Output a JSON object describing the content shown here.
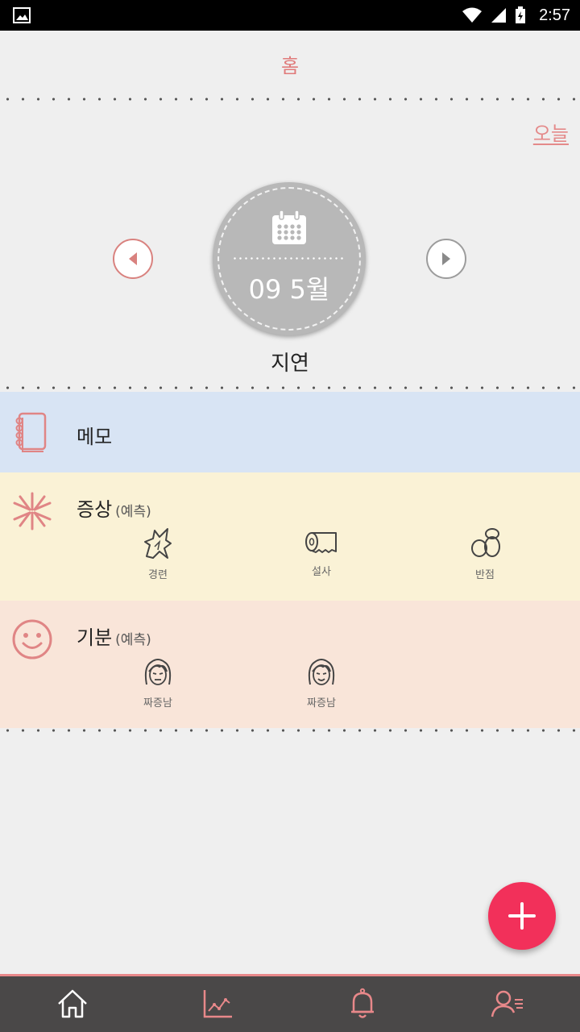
{
  "status_bar": {
    "time": "2:57"
  },
  "header": {
    "title": "홈"
  },
  "today_link": "오늘",
  "date_selector": {
    "date": "09 5월",
    "status": "지연"
  },
  "sections": {
    "memo": {
      "title": "메모"
    },
    "symptom": {
      "title": "증상",
      "subtitle": "(예측)",
      "items": [
        {
          "icon": "cramp-icon",
          "label": "경련"
        },
        {
          "icon": "toilet-paper-icon",
          "label": "설사"
        },
        {
          "icon": "spots-icon",
          "label": "반점"
        }
      ]
    },
    "mood": {
      "title": "기분",
      "subtitle": "(예측)",
      "items": [
        {
          "icon": "annoyed-face-icon",
          "label": "짜증남"
        },
        {
          "icon": "annoyed-face-icon",
          "label": "짜증남"
        }
      ]
    }
  },
  "bottom_nav": [
    "home-icon",
    "chart-icon",
    "bell-icon",
    "profile-icon"
  ],
  "colors": {
    "accent": "#e07b7b",
    "fab": "#f2305a",
    "memo_bg": "#d8e4f4",
    "symptom_bg": "#faf2d6",
    "mood_bg": "#f9e5d9",
    "nav_bg": "#4a4848"
  }
}
